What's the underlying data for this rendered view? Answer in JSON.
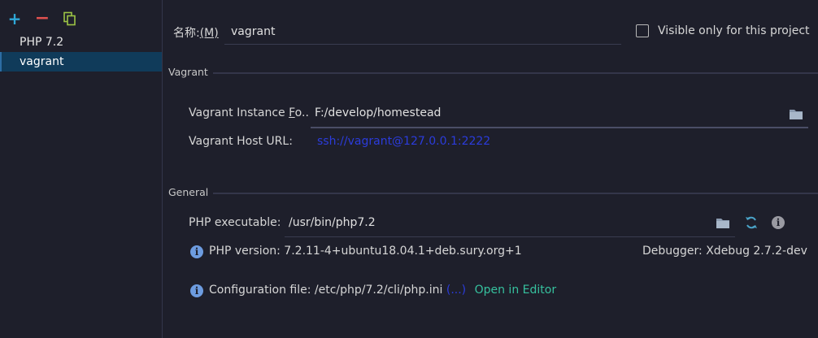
{
  "toolbar": {
    "add_label": "+",
    "remove_label": "−"
  },
  "sidebar": {
    "items": [
      {
        "label": "PHP 7.2"
      },
      {
        "label": "vagrant"
      }
    ]
  },
  "form": {
    "name_label": "名称:",
    "name_mnemonic": "(M)",
    "name_value": "vagrant",
    "visible_only_label": "Visible only for this project"
  },
  "vagrant": {
    "section_title": "Vagrant",
    "instance_label_prefix": "Vagrant Instance ",
    "instance_label_mnemonic": "F",
    "instance_label_suffix": "o..",
    "instance_value": "F:/develop/homestead",
    "host_url_label": "Vagrant Host URL:",
    "host_url_value": "ssh://vagrant@127.0.0.1:2222"
  },
  "general": {
    "section_title": "General",
    "php_exec_label": "PHP executable:",
    "php_exec_value": "/usr/bin/php7.2",
    "php_version_text": "PHP version: 7.2.11-4+ubuntu18.04.1+deb.sury.org+1",
    "debugger_text": "Debugger: Xdebug 2.7.2-dev",
    "config_file_text": "Configuration file: /etc/php/7.2/cli/php.ini",
    "config_more_text": "(...)",
    "open_editor_text": "Open in Editor"
  },
  "colors": {
    "background": "#1e1f2b",
    "selection": "#103b5a",
    "link_blue": "#2b3cdc",
    "link_green": "#36c19e",
    "info_icon": "#6d9ce0"
  }
}
